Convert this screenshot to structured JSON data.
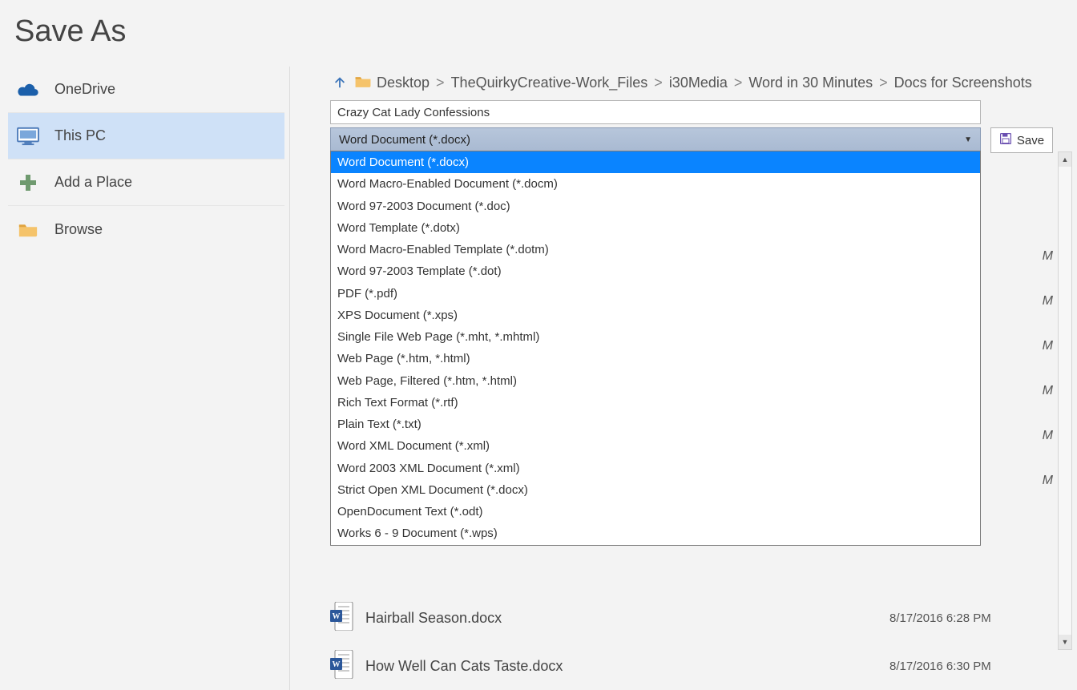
{
  "title": "Save As",
  "sidebar": {
    "items": [
      {
        "label": "OneDrive"
      },
      {
        "label": "This PC"
      },
      {
        "label": "Add a Place"
      },
      {
        "label": "Browse"
      }
    ]
  },
  "crumbs": [
    "Desktop",
    "TheQuirkyCreative-Work_Files",
    "i30Media",
    "Word in 30 Minutes",
    "Docs for Screenshots"
  ],
  "filename": "Crazy Cat Lady Confessions",
  "filetype_selected": "Word Document (*.docx)",
  "save_label": "Save",
  "filetype_options": [
    "Word Document (*.docx)",
    "Word Macro-Enabled Document (*.docm)",
    "Word 97-2003 Document (*.doc)",
    "Word Template (*.dotx)",
    "Word Macro-Enabled Template (*.dotm)",
    "Word 97-2003 Template (*.dot)",
    "PDF (*.pdf)",
    "XPS Document (*.xps)",
    "Single File Web Page (*.mht, *.mhtml)",
    "Web Page (*.htm, *.html)",
    "Web Page, Filtered (*.htm, *.html)",
    "Rich Text Format (*.rtf)",
    "Plain Text (*.txt)",
    "Word XML Document (*.xml)",
    "Word 2003 XML Document (*.xml)",
    "Strict Open XML Document (*.docx)",
    "OpenDocument Text (*.odt)",
    "Works 6 - 9 Document (*.wps)"
  ],
  "files": [
    {
      "name": "Hairball Season.docx",
      "date": "8/17/2016 6:28 PM"
    },
    {
      "name": "How Well Can Cats Taste.docx",
      "date": "8/17/2016 6:30 PM"
    }
  ],
  "bg_marker": "M"
}
